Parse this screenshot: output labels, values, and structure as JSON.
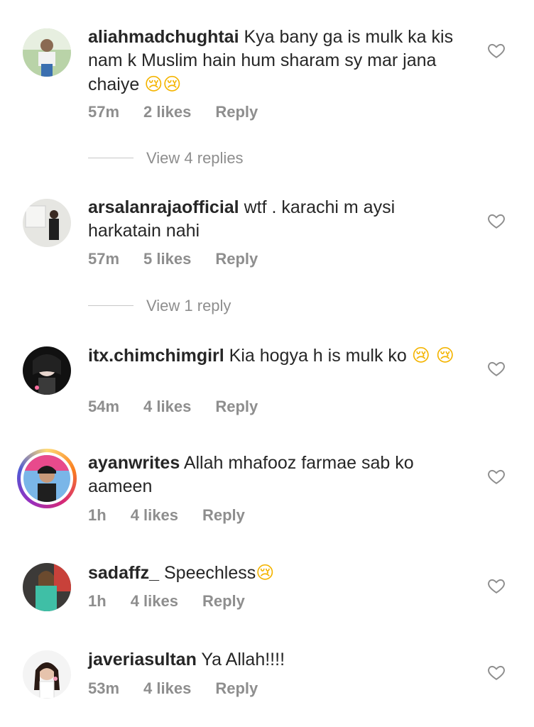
{
  "comments": [
    {
      "username": "aliahmadchughtai",
      "text": "Kya bany ga is mulk ka kis nam k Muslim hain hum sharam sy mar jana chaiye",
      "emoji": "😢😢",
      "time": "57m",
      "likes": "2 likes",
      "reply": "Reply",
      "view_replies": "View 4 replies"
    },
    {
      "username": "arsalanrajaofficial",
      "text": "wtf . karachi m aysi harkatain nahi",
      "emoji": "",
      "time": "57m",
      "likes": "5 likes",
      "reply": "Reply",
      "view_replies": "View 1 reply"
    },
    {
      "username": "itx.chimchimgirl",
      "text": "Kia hogya h is mulk ko",
      "emoji": "😢 😢",
      "time": "54m",
      "likes": "4 likes",
      "reply": "Reply"
    },
    {
      "username": "ayanwrites",
      "text": "Allah mhafooz farmae sab ko aameen",
      "emoji": "",
      "time": "1h",
      "likes": "4 likes",
      "reply": "Reply"
    },
    {
      "username": "sadaffz_",
      "text": "Speechless",
      "emoji": "😢",
      "time": "1h",
      "likes": "4 likes",
      "reply": "Reply"
    },
    {
      "username": "javeriasultan",
      "text": "Ya Allah!!!!",
      "emoji": "",
      "time": "53m",
      "likes": "4 likes",
      "reply": "Reply"
    }
  ],
  "icons": {
    "like": "heart-outline-icon",
    "avatar": "profile-photo"
  },
  "colors": {
    "text": "#262626",
    "muted": "#8e8e8e",
    "story_ring": "#d62976"
  }
}
